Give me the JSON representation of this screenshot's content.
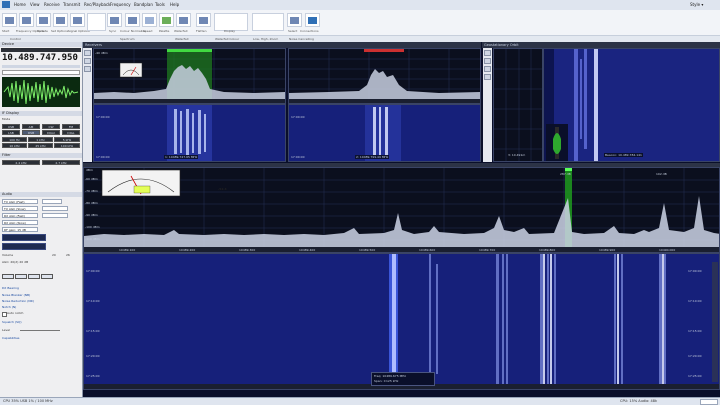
{
  "titlebar": {
    "menus": [
      "Home",
      "View",
      "Receive",
      "Transmit",
      "Rec/Playback",
      "Frequency",
      "Bandplan",
      "Tools",
      "Help"
    ],
    "right": "Style ▾"
  },
  "ribbon": {
    "groups": [
      "Control",
      "",
      "Spectrum",
      "Waterfall",
      "Waterfall Colour",
      "Low, High, Zoom",
      "",
      "",
      "",
      "Noise Cancelling"
    ],
    "buttons": [
      "Start",
      "Frequency Options",
      "Update",
      "Set Options",
      "Sync",
      "Signal Options",
      "Colour Normalise",
      "Speed",
      "Palette",
      "Waterfall",
      "Flatten",
      "Display",
      "Select",
      "Colours",
      "Connections"
    ]
  },
  "left": {
    "header": "Device",
    "freq": "10.489.747.950",
    "sub_freq": "10.489.747.950 Hz",
    "mode_label": "Mode",
    "if_display": "IF Display",
    "mode_buttons": [
      "USB",
      "AM",
      "CW",
      "FM",
      "LSB",
      "DSB",
      "DIGU",
      "DIGL"
    ],
    "steps": [
      "100 Hz",
      "1 kHz",
      "5 kHz",
      "10 kHz",
      "25 kHz",
      "100 kHz"
    ],
    "filter_label": "Filter",
    "filter_values": [
      "2.4 kHz",
      "2.7 kHz"
    ],
    "audio_label": "Audio",
    "audio_items": [
      "TX AGC (Fast)",
      "TX AGC (Slow)",
      "RX AGC (Fast)",
      "RX AGC (Slow)",
      "RF gain: 15 dB"
    ],
    "vol_label": "Volume",
    "vol_values": [
      "20",
      "26"
    ],
    "agc_txt": "AGC: 20(d) 20 dB",
    "checks": [
      "Noise Blanker (NB)",
      "Noise Reduction (NR)",
      "Notch (N)",
      "Auto notch"
    ],
    "squelch": "Squelch (SQ)",
    "level": "Level",
    "rig_control": "DX Bearing",
    "capabilities": "Capabilities"
  },
  "scopes": {
    "header_left": "Receivers",
    "header_right": "Geostationary Orbit",
    "rx1": {
      "freq": "1: 10489.747.95 MHz",
      "db_top": "-40 dBm"
    },
    "rx2": {
      "freq": "2: 10489.799.49 MHz"
    },
    "waterfall_time": "17:00:00",
    "small": {
      "label": "Beacon: 10.489.784.141",
      "freq": "3: 10.491m"
    },
    "main": {
      "db_label": "dBm",
      "meter_value": "-52.4",
      "marker_left": "287 dB",
      "marker_right": "102 dB",
      "x_ticks": [
        "10489.100",
        "10489.200",
        "10489.300",
        "10489.400",
        "10489.500",
        "10489.600",
        "10489.700",
        "10489.800",
        "10489.900",
        "10490.000",
        "10490.100"
      ],
      "y_ticks": [
        "-60 dBm",
        "-70 dBm",
        "-80 dBm",
        "-90 dBm",
        "-100 dBm",
        "-110 dBm",
        "-120 dBm"
      ],
      "wf_times": [
        "17:00:00",
        "17:10:00",
        "17:15:00",
        "17:20:00",
        "17:25:00"
      ],
      "cursor_freq": "Freq: 10489.675 MHz",
      "cursor_span": "Span: ±125 kHz"
    }
  },
  "status": {
    "left": "CPU 35%  USB 1% / 100 MHz",
    "right": "CPU: 15%  Audio: 48k"
  }
}
